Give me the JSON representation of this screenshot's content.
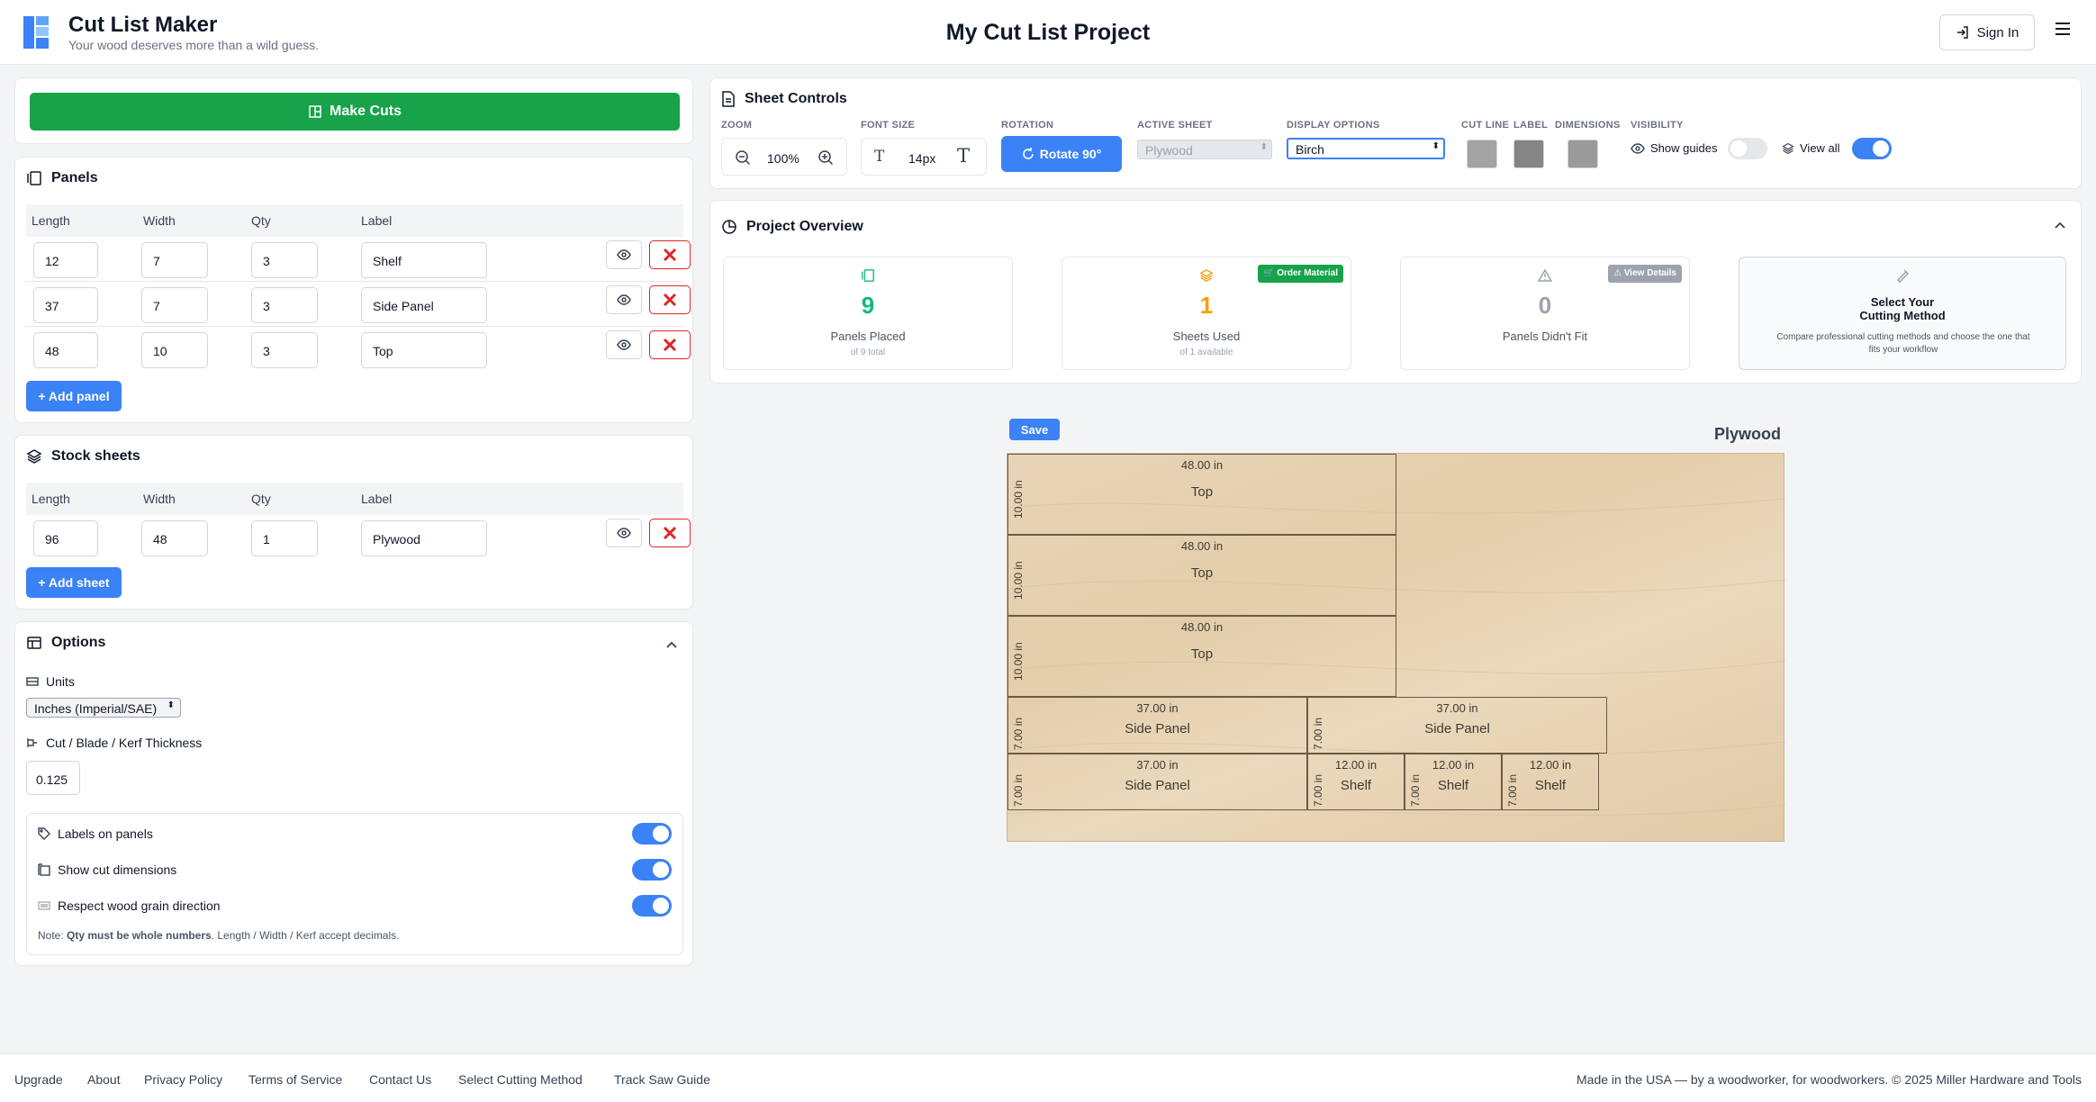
{
  "header": {
    "app_title": "Cut List Maker",
    "tagline": "Your wood deserves more than a wild guess.",
    "project_title": "My Cut List Project",
    "sign_in": "Sign In"
  },
  "actions": {
    "make_cuts": "Make Cuts"
  },
  "panels": {
    "title": "Panels",
    "columns": [
      "Length",
      "Width",
      "Qty",
      "Label"
    ],
    "rows": [
      {
        "length": "12",
        "width": "7",
        "qty": "3",
        "label": "Shelf"
      },
      {
        "length": "37",
        "width": "7",
        "qty": "3",
        "label": "Side Panel"
      },
      {
        "length": "48",
        "width": "10",
        "qty": "3",
        "label": "Top"
      }
    ],
    "add_label": "+ Add panel"
  },
  "stock": {
    "title": "Stock sheets",
    "columns": [
      "Length",
      "Width",
      "Qty",
      "Label"
    ],
    "rows": [
      {
        "length": "96",
        "width": "48",
        "qty": "1",
        "label": "Plywood"
      }
    ],
    "add_label": "+ Add sheet"
  },
  "options": {
    "title": "Options",
    "units_label": "Units",
    "units_value": "Inches (Imperial/SAE)",
    "kerf_label": "Cut / Blade / Kerf Thickness",
    "kerf_value": "0.125",
    "toggles": [
      {
        "label": "Labels on panels",
        "on": true
      },
      {
        "label": "Show cut dimensions",
        "on": true
      },
      {
        "label": "Respect wood grain direction",
        "on": true
      }
    ],
    "note_prefix": "Note: ",
    "note_bold": "Qty must be whole numbers",
    "note_rest": ". Length / Width / Kerf accept decimals."
  },
  "sheet_controls": {
    "title": "Sheet Controls",
    "zoom_label": "ZOOM",
    "zoom_value": "100%",
    "font_label": "FONT SIZE",
    "font_value": "14px",
    "rotation_label": "ROTATION",
    "rotate_btn": "Rotate 90°",
    "active_sheet_label": "ACTIVE SHEET",
    "active_sheet_value": "Plywood",
    "display_label": "DISPLAY OPTIONS",
    "display_value": "Birch",
    "cutline_label": "CUT LINE",
    "label_label": "LABEL",
    "dimensions_label": "DIMENSIONS",
    "visibility_label": "VISIBILITY",
    "show_guides": "Show guides",
    "show_guides_on": false,
    "view_all": "View all",
    "view_all_on": true,
    "swatch_colors": {
      "cut_line": "#a3a3a3",
      "label": "#858585",
      "dimensions": "#9a9a9a"
    }
  },
  "overview": {
    "title": "Project Overview",
    "stats": [
      {
        "value": "9",
        "label": "Panels Placed",
        "sub": "of 9 total",
        "color": "#10b981"
      },
      {
        "value": "1",
        "label": "Sheets Used",
        "sub": "of 1 available",
        "color": "#f59e0b",
        "badge": "Order Material"
      },
      {
        "value": "0",
        "label": "Panels Didn't Fit",
        "sub": "",
        "color": "#9ca3af",
        "badge": "View Details"
      }
    ],
    "method_title_1": "Select Your",
    "method_title_2": "Cutting Method",
    "method_desc": "Compare professional cutting methods and choose the one that fits your workflow"
  },
  "sheet": {
    "save_label": "Save",
    "name": "Plywood",
    "length": 96,
    "width": 48,
    "pieces": [
      {
        "x": 0,
        "y": 0,
        "l": 48,
        "w": 10,
        "label": "Top",
        "dim_w": "48.00 in",
        "dim_h": "10.00 in"
      },
      {
        "x": 0,
        "y": 10,
        "l": 48,
        "w": 10,
        "label": "Top",
        "dim_w": "48.00 in",
        "dim_h": "10.00 in"
      },
      {
        "x": 0,
        "y": 20,
        "l": 48,
        "w": 10,
        "label": "Top",
        "dim_w": "48.00 in",
        "dim_h": "10.00 in"
      },
      {
        "x": 0,
        "y": 30,
        "l": 37,
        "w": 7,
        "label": "Side Panel",
        "dim_w": "37.00 in",
        "dim_h": "7.00 in"
      },
      {
        "x": 37,
        "y": 30,
        "l": 37,
        "w": 7,
        "label": "Side Panel",
        "dim_w": "37.00 in",
        "dim_h": "7.00 in"
      },
      {
        "x": 0,
        "y": 37,
        "l": 37,
        "w": 7,
        "label": "Side Panel",
        "dim_w": "37.00 in",
        "dim_h": "7.00 in"
      },
      {
        "x": 37,
        "y": 37,
        "l": 12,
        "w": 7,
        "label": "Shelf",
        "dim_w": "12.00 in",
        "dim_h": "7.00 in"
      },
      {
        "x": 49,
        "y": 37,
        "l": 12,
        "w": 7,
        "label": "Shelf",
        "dim_w": "12.00 in",
        "dim_h": "7.00 in"
      },
      {
        "x": 61,
        "y": 37,
        "l": 12,
        "w": 7,
        "label": "Shelf",
        "dim_w": "12.00 in",
        "dim_h": "7.00 in"
      }
    ]
  },
  "footer": {
    "links": [
      "Upgrade",
      "About",
      "Privacy Policy",
      "Terms of Service",
      "Contact Us",
      "Select Cutting Method",
      "Track Saw Guide"
    ],
    "credit": "Made in the USA — by a woodworker, for woodworkers. © 2025 Miller Hardware and Tools"
  }
}
